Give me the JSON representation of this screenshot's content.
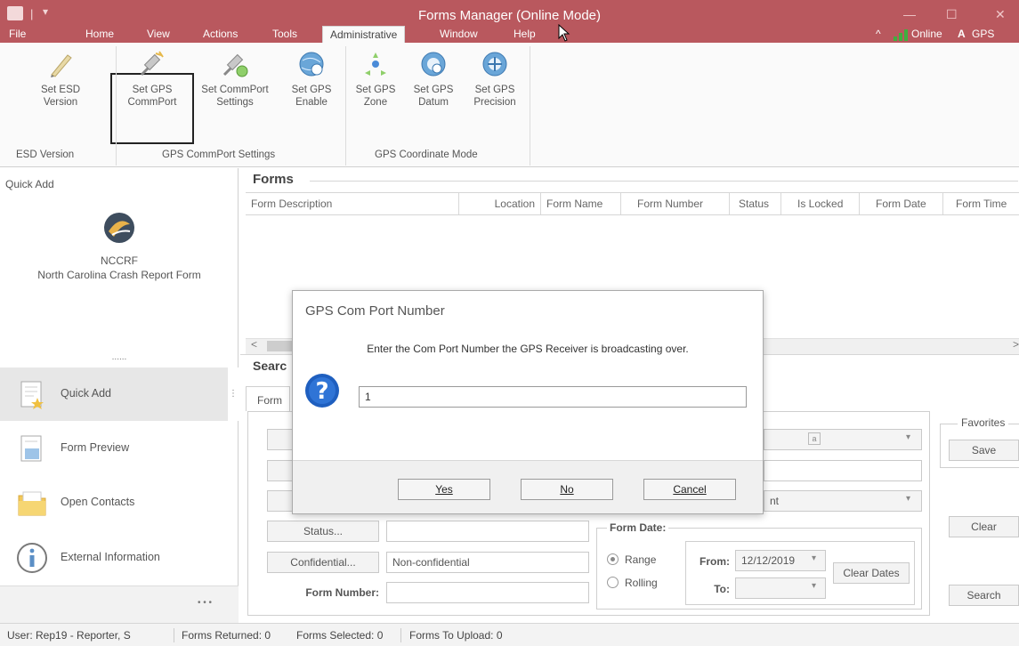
{
  "window": {
    "title": "Forms Manager (Online Mode)",
    "minimize": "—",
    "maximize": "☐",
    "close": "✕"
  },
  "menu": [
    "File",
    "Home",
    "View",
    "Actions",
    "Tools",
    "Administrative",
    "Window",
    "Help"
  ],
  "menu_right": {
    "online": "Online",
    "gps": "GPS"
  },
  "ribbon": {
    "buttons": [
      {
        "line1": "Set ESD",
        "line2": "Version",
        "icon": "pencil-icon"
      },
      {
        "line1": "Set GPS",
        "line2": "CommPort",
        "icon": "satellite-icon"
      },
      {
        "line1": "Set CommPort",
        "line2": "Settings",
        "icon": "satellite-settings-icon"
      },
      {
        "line1": "Set GPS",
        "line2": "Enable",
        "icon": "globe-enable-icon"
      },
      {
        "line1": "Set GPS",
        "line2": "Zone",
        "icon": "zone-icon"
      },
      {
        "line1": "Set GPS",
        "line2": "Datum",
        "icon": "datum-icon"
      },
      {
        "line1": "Set GPS",
        "line2": "Precision",
        "icon": "precision-icon"
      }
    ],
    "groups": [
      "ESD Version",
      "GPS CommPort Settings",
      "GPS Coordinate Mode"
    ]
  },
  "quick_add": {
    "title": "Quick Add",
    "item_code": "NCCRF",
    "item_name": "North Carolina Crash Report Form",
    "dots": "......"
  },
  "nav": [
    {
      "label": "Quick Add",
      "icon": "quick-add-icon"
    },
    {
      "label": "Form Preview",
      "icon": "form-preview-icon"
    },
    {
      "label": "Open Contacts",
      "icon": "folder-icon"
    },
    {
      "label": "External Information",
      "icon": "info-icon"
    }
  ],
  "nav_more": "• • •",
  "forms": {
    "title": "Forms",
    "columns": [
      "Form Description",
      "Location",
      "Form Name",
      "Form Number",
      "Status",
      "Is Locked",
      "Form Date",
      "Form Time"
    ]
  },
  "search": {
    "title": "Searc",
    "tab": "Form",
    "status_btn": "Status...",
    "status_value": "",
    "confidential_btn": "Confidential...",
    "confidential_value": "Non-confidential",
    "form_number_label": "Form Number:",
    "form_number_value": "",
    "right_select_value": "nt",
    "form_date_label": "Form Date:",
    "range": "Range",
    "rolling": "Rolling",
    "from_label": "From:",
    "from_value": "12/12/2019",
    "to_label": "To:",
    "to_value": "",
    "clear_dates": "Clear Dates",
    "favorites": "Favorites",
    "save": "Save",
    "clear": "Clear",
    "search_btn": "Search"
  },
  "dialog": {
    "title": "GPS Com Port Number",
    "message": "Enter the Com Port Number the GPS Receiver is broadcasting over.",
    "input_value": "1",
    "yes": "Yes",
    "no": "No",
    "cancel": "Cancel"
  },
  "statusbar": {
    "user": "User: Rep19 - Reporter, S",
    "returned": "Forms Returned: 0",
    "selected": "Forms Selected: 0",
    "upload": "Forms To Upload: 0"
  }
}
